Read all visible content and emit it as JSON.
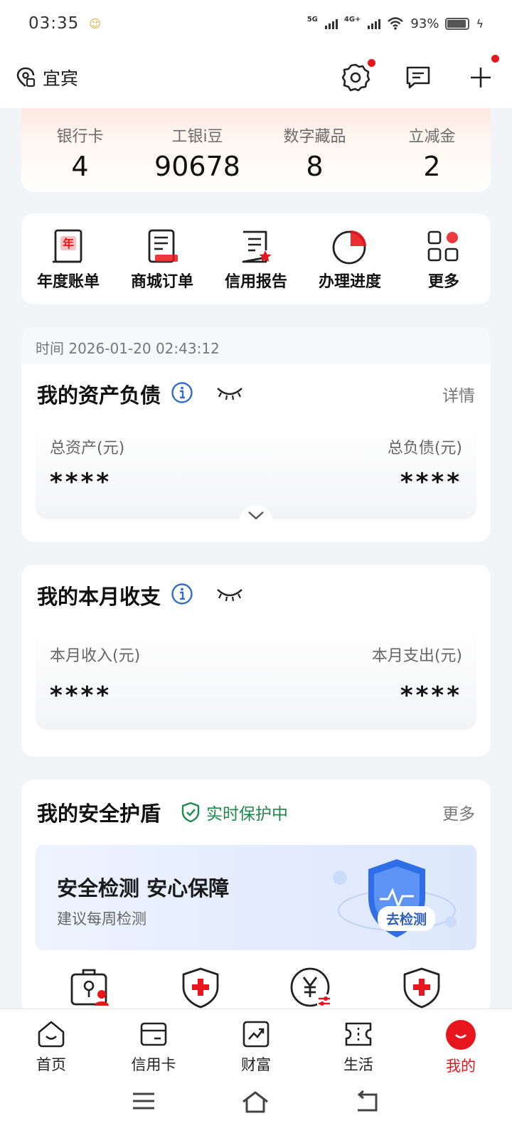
{
  "status": {
    "time": "03:35",
    "sig1": "5G",
    "sig2": "4G+",
    "battery": "93%",
    "battery_level": 0.93
  },
  "header": {
    "location": "宜宾"
  },
  "stats": [
    {
      "label": "银行卡",
      "value": "4"
    },
    {
      "label": "工银i豆",
      "value": "90678"
    },
    {
      "label": "数字藏品",
      "value": "8"
    },
    {
      "label": "立减金",
      "value": "2"
    }
  ],
  "quick": [
    {
      "label": "年度账单",
      "icon": "annual-bill-icon"
    },
    {
      "label": "商城订单",
      "icon": "mall-order-icon"
    },
    {
      "label": "信用报告",
      "icon": "credit-report-icon"
    },
    {
      "label": "办理进度",
      "icon": "progress-icon"
    },
    {
      "label": "更多",
      "icon": "more-grid-icon"
    }
  ],
  "assets": {
    "time": "时间 2026-01-20 02:43:12",
    "title": "我的资产负债",
    "detail": "详情",
    "left_label": "总资产(元)",
    "left_value": "****",
    "right_label": "总负债(元)",
    "right_value": "****"
  },
  "monthly": {
    "title": "我的本月收支",
    "left_label": "本月收入(元)",
    "left_value": "****",
    "right_label": "本月支出(元)",
    "right_value": "****"
  },
  "shield": {
    "title": "我的安全护盾",
    "protect": "实时保护中",
    "more": "更多",
    "banner_title": "安全检测 安心保障",
    "banner_sub": "建议每周检测",
    "banner_button": "去检测"
  },
  "tabs": [
    {
      "label": "首页",
      "icon": "home-icon"
    },
    {
      "label": "信用卡",
      "icon": "credit-card-icon"
    },
    {
      "label": "财富",
      "icon": "wealth-icon"
    },
    {
      "label": "生活",
      "icon": "life-ticket-icon"
    },
    {
      "label": "我的",
      "icon": "mine-icon"
    }
  ],
  "colors": {
    "accent": "#e8161c",
    "protect_green": "#1e8a4c",
    "info_blue": "#2f6dc9"
  }
}
